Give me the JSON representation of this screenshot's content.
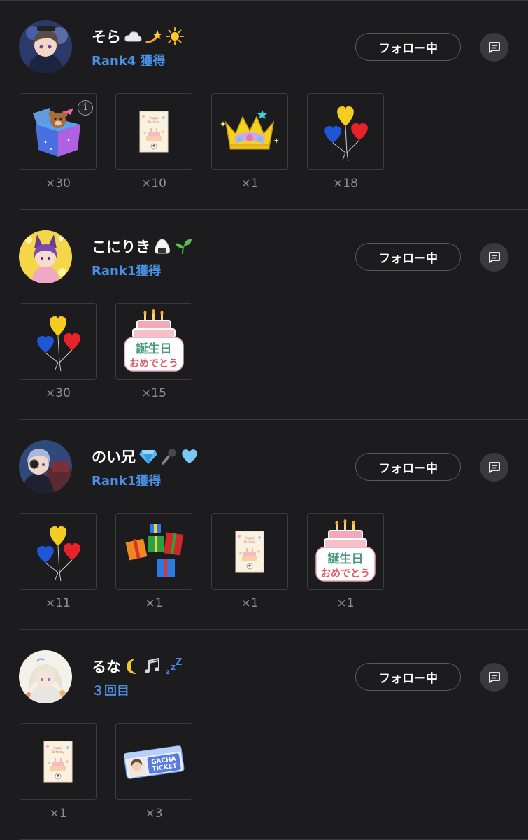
{
  "users": [
    {
      "name": "そら",
      "emojis": [
        "cloud-emoji",
        "dizzy-emoji",
        "sun-emoji"
      ],
      "rank": "Rank4 獲得",
      "follow_label": "フォロー中",
      "gifts": [
        {
          "icon": "teddy-gift-box-icon",
          "count": "×30",
          "info": "i"
        },
        {
          "icon": "birthday-card-icon",
          "count": "×10"
        },
        {
          "icon": "crown-icon",
          "count": "×1"
        },
        {
          "icon": "heart-balloons-icon",
          "count": "×18"
        }
      ]
    },
    {
      "name": "こにりき",
      "emojis": [
        "rice-ball-emoji",
        "seedling-emoji"
      ],
      "rank": "Rank1獲得",
      "follow_label": "フォロー中",
      "gifts": [
        {
          "icon": "heart-balloons-icon",
          "count": "×30"
        },
        {
          "icon": "birthday-cake-sticker-icon",
          "count": "×15",
          "sticker_top": "誕生日",
          "sticker_bottom": "おめでとう"
        }
      ]
    },
    {
      "name": "のい兄",
      "emojis": [
        "gem-emoji",
        "microphone-emoji",
        "blue-heart-emoji"
      ],
      "rank": "Rank1獲得",
      "follow_label": "フォロー中",
      "gifts": [
        {
          "icon": "heart-balloons-icon",
          "count": "×11"
        },
        {
          "icon": "present-boxes-icon",
          "count": "×1"
        },
        {
          "icon": "birthday-card-icon",
          "count": "×1"
        },
        {
          "icon": "birthday-cake-sticker-icon",
          "count": "×1",
          "sticker_top": "誕生日",
          "sticker_bottom": "おめでとう"
        }
      ]
    },
    {
      "name": "るな",
      "emojis": [
        "crescent-moon-emoji",
        "music-notes-emoji",
        "zzz-emoji"
      ],
      "rank": "３回目",
      "follow_label": "フォロー中",
      "gifts": [
        {
          "icon": "birthday-card-icon",
          "count": "×1"
        },
        {
          "icon": "gacha-ticket-icon",
          "count": "×3",
          "ticket_line1": "GACHA",
          "ticket_line2": "TICKET"
        }
      ]
    }
  ],
  "colors": {
    "background": "#1c1c1e",
    "rank_blue": "#4a90e2",
    "count_gray": "#8e8e93"
  }
}
